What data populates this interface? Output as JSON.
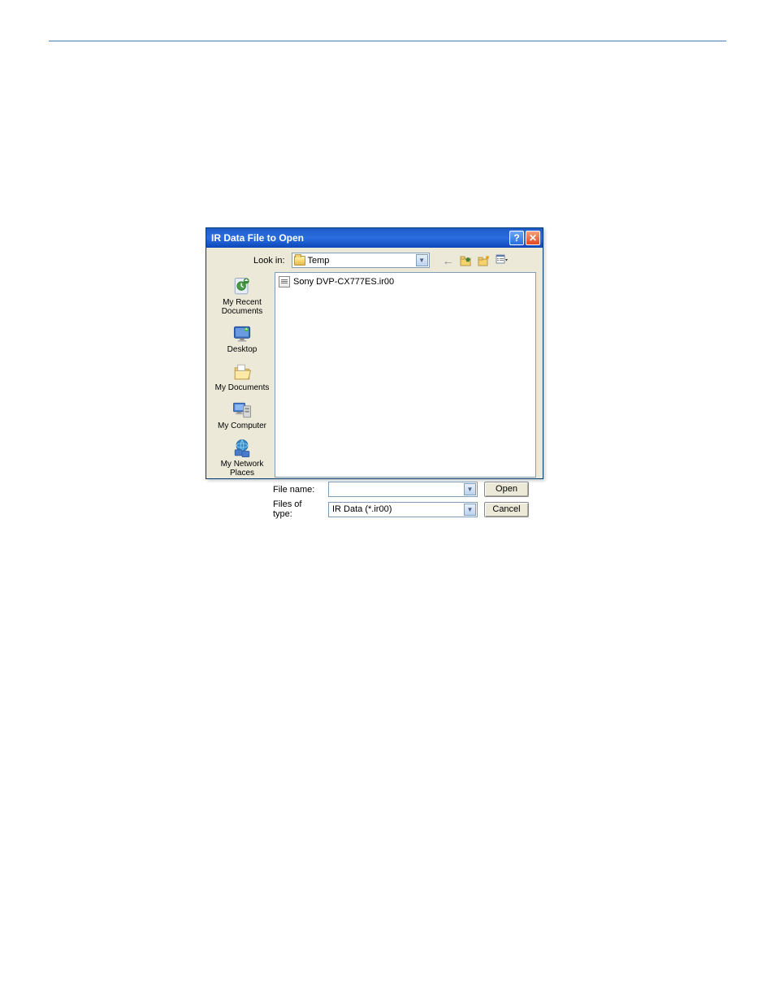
{
  "dialog": {
    "title": "IR Data File to Open",
    "lookin_label": "Look in:",
    "lookin_value": "Temp",
    "places": {
      "recent": "My Recent Documents",
      "desktop": "Desktop",
      "mydocs": "My Documents",
      "mycomp": "My Computer",
      "mynet": "My Network Places"
    },
    "file_list": [
      "Sony DVP-CX777ES.ir00"
    ],
    "filename_label": "File name:",
    "filename_value": "",
    "filetype_label": "Files of type:",
    "filetype_value": "IR Data (*.ir00)",
    "open_btn": "Open",
    "cancel_btn": "Cancel"
  }
}
